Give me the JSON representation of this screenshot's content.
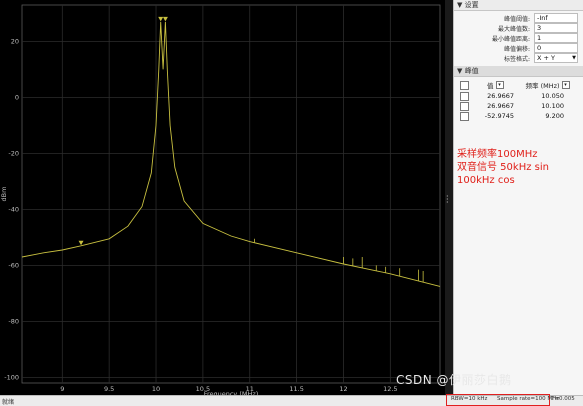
{
  "settings": {
    "header": "设置",
    "rows": [
      {
        "label": "峰值阈值:",
        "value": "-Inf"
      },
      {
        "label": "最大峰值数:",
        "value": "3"
      },
      {
        "label": "最小峰值距离:",
        "value": "1"
      },
      {
        "label": "峰值偏移:",
        "value": "0"
      },
      {
        "label": "标签格式:",
        "value": "X + Y"
      }
    ]
  },
  "peaks": {
    "header": "峰值",
    "col_value": "值",
    "col_freq": "频率 (MHz)",
    "rows": [
      {
        "value": "26.9667",
        "freq": "10.050"
      },
      {
        "value": "26.9667",
        "freq": "10.100"
      },
      {
        "value": "-52.9745",
        "freq": "9.200"
      }
    ]
  },
  "annotation": {
    "line1": "采样频率100MHz",
    "line2": "双音信号 50kHz sin",
    "line3": "100kHz cos"
  },
  "status": {
    "left": "就绪",
    "rbw": "RBW=10 kHz",
    "sample_rate": "Sample rate=100 MHz",
    "t": "T=0.005"
  },
  "watermark": "CSDN @伊丽莎白鹅",
  "chart_data": {
    "type": "line",
    "xlabel": "Frequency (MHz)",
    "ylabel": "dBm",
    "xlim": [
      8.57,
      13.03
    ],
    "ylim": [
      -102,
      33
    ],
    "xticks": [
      9,
      9.5,
      10,
      10.5,
      11,
      11.5,
      12,
      12.5
    ],
    "yticks": [
      20,
      0,
      -20,
      -40,
      -60,
      -80,
      -100
    ],
    "grid": true,
    "line_color": "#c8c040",
    "series": [
      {
        "x": [
          8.57,
          8.8,
          9.0,
          9.2,
          9.5,
          9.7,
          9.85,
          9.95,
          10.0,
          10.03,
          10.05,
          10.075,
          10.1,
          10.12,
          10.15,
          10.2,
          10.3,
          10.5,
          10.8,
          11.0,
          11.5,
          12.0,
          12.5,
          13.03
        ],
        "y": [
          -57,
          -55.5,
          -54.5,
          -53,
          -50.5,
          -46,
          -39,
          -27,
          -10,
          10,
          26.97,
          10,
          26.97,
          10,
          -10,
          -25,
          -37,
          -45,
          -49.5,
          -51.5,
          -55.5,
          -59.5,
          -63,
          -67.5
        ]
      }
    ],
    "spurs": [
      {
        "x": 11.05,
        "y": -50.5
      },
      {
        "x": 12.0,
        "y": -57
      },
      {
        "x": 12.1,
        "y": -57.5
      },
      {
        "x": 12.2,
        "y": -57
      },
      {
        "x": 12.35,
        "y": -60
      },
      {
        "x": 12.45,
        "y": -60.5
      },
      {
        "x": 12.6,
        "y": -61
      },
      {
        "x": 12.8,
        "y": -61.5
      },
      {
        "x": 12.85,
        "y": -62
      }
    ],
    "markers": [
      {
        "x": 10.05,
        "y": 26.97
      },
      {
        "x": 10.1,
        "y": 26.97
      },
      {
        "x": 9.2,
        "y": -52.97
      }
    ]
  }
}
